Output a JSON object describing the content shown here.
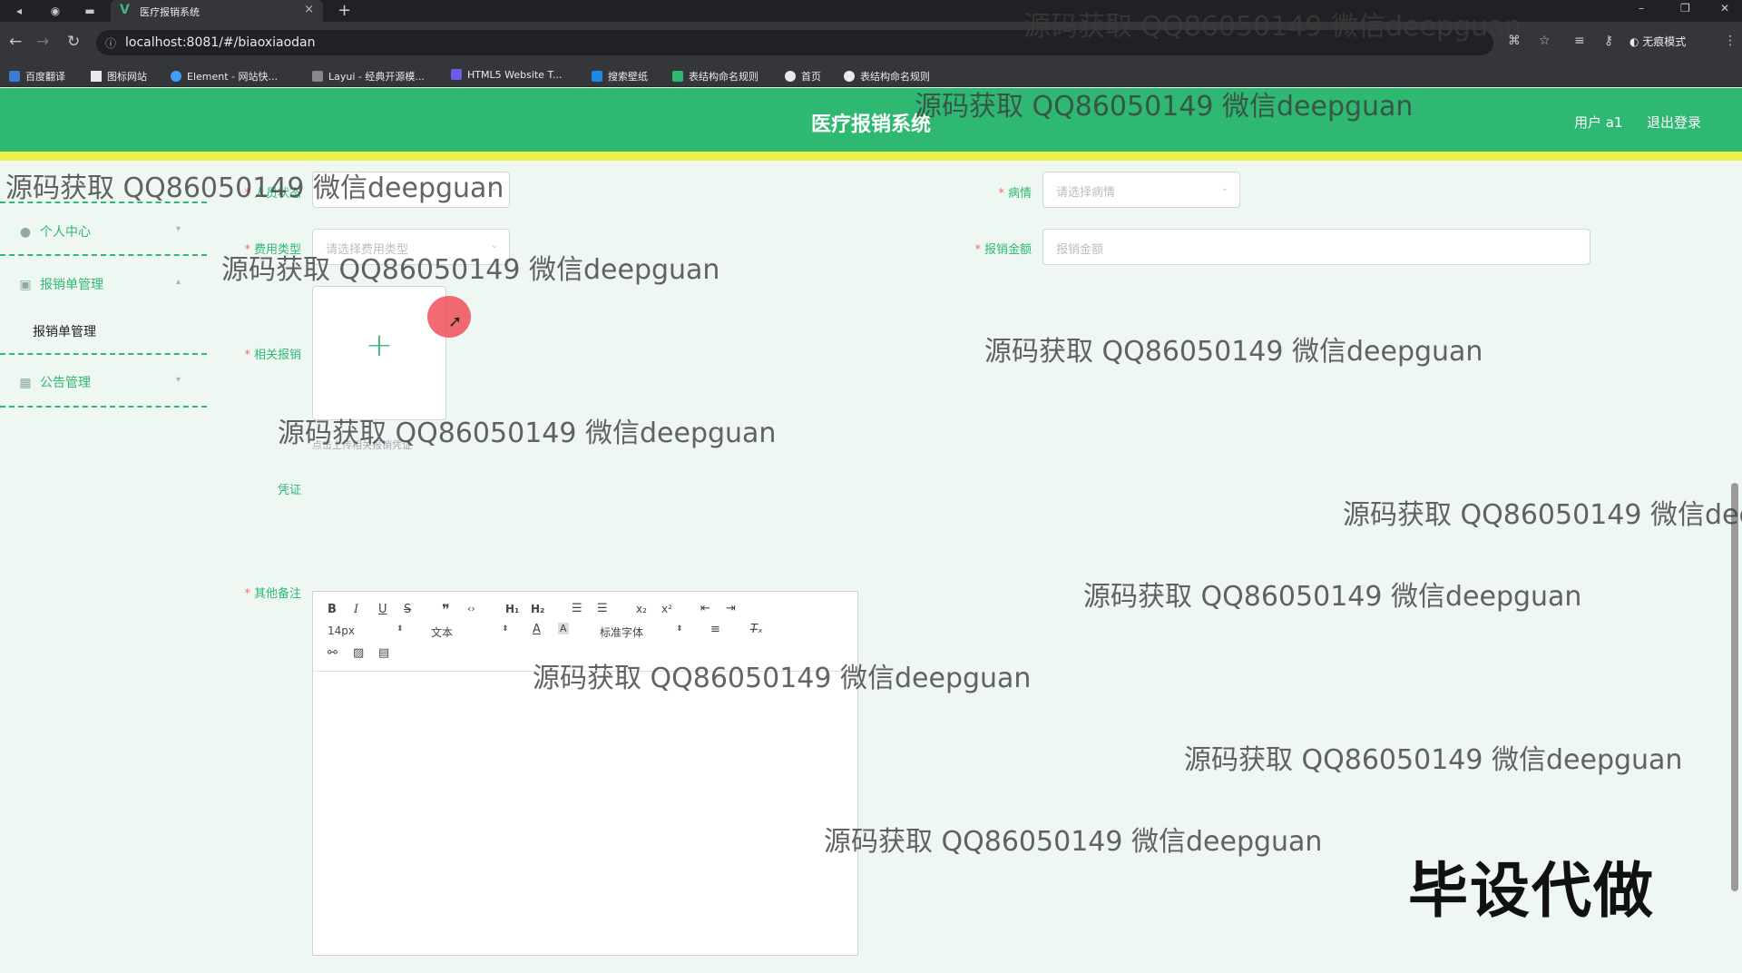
{
  "browser": {
    "tab_title": "医疗报销系统",
    "url": "localhost:8081/#/biaoxiaodan",
    "incognito_label": "无痕模式",
    "bookmarks": [
      "百度翻译",
      "图标网站",
      "Element - 网站快...",
      "Layui - 经典开源模...",
      "HTML5 Website T...",
      "搜索壁纸",
      "表结构命名规则",
      "首页",
      "表结构命名规则"
    ]
  },
  "header": {
    "title": "医疗报销系统",
    "user": "用户 a1",
    "logout": "退出登录"
  },
  "sidebar": {
    "items": [
      {
        "label": "个人中心"
      },
      {
        "label": "报销单管理"
      },
      {
        "label": "公告管理"
      }
    ],
    "submenu": "报销单管理"
  },
  "form": {
    "row1_left_label": "人员状态",
    "row1_right_label": "病情",
    "row1_right_placeholder": "请选择病情",
    "row2_left_label": "费用类型",
    "row2_left_placeholder": "请选择费用类型",
    "row2_right_label": "报销金额",
    "row2_right_placeholder": "报销金额",
    "upload_label": "相关报销",
    "upload_tip": "点击上传相关报销凭证",
    "voucher_label": "凭证",
    "remark_label": "其他备注"
  },
  "editor": {
    "font_size": "14px",
    "paragraph": "文本",
    "font_family": "标准字体"
  },
  "overlay": {
    "watermark": "源码获取 QQ86050149 微信deepguan",
    "watermark_cut": "源码获取 QQ86050149 微信dee",
    "promo": "毕设代做"
  }
}
